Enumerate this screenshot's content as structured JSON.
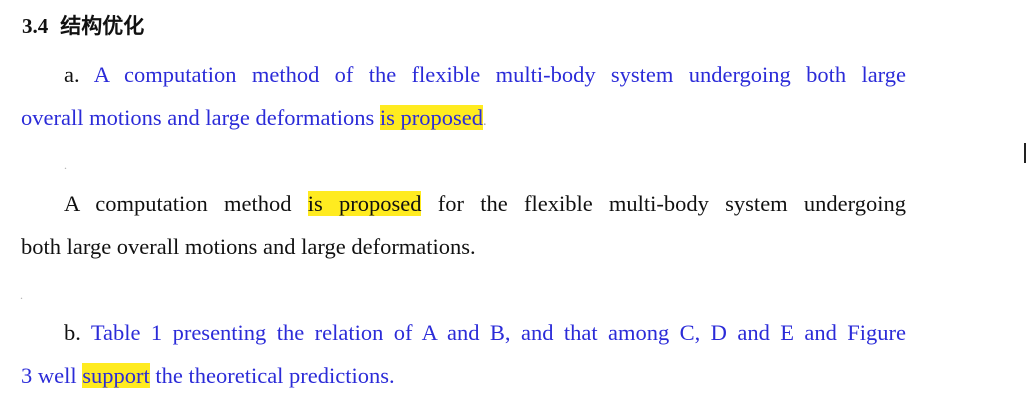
{
  "section": {
    "number": "3.4",
    "title": "结构优化"
  },
  "example_a": {
    "label": "a.",
    "line1": "A computation method of the flexible multi-body system undergoing both large",
    "line2_prefix": "overall motions and large deformations ",
    "line2_highlight": "is proposed",
    "line2_suffix": "."
  },
  "revision_a": {
    "line1_prefix": "A computation method ",
    "line1_highlight": "is proposed",
    "line1_suffix": " for the flexible multi-body system undergoing",
    "line2": "both large overall motions and large deformations."
  },
  "example_b": {
    "label": "b.",
    "line1": "Table 1 presenting the relation of A and B, and that among C, D and E and Figure",
    "line2_prefix": "3 well ",
    "line2_highlight": "support",
    "line2_suffix": " the theoretical predictions."
  },
  "colors": {
    "example_text": "#2b2bd8",
    "highlight": "#ffeb20",
    "body_text": "#111111"
  }
}
